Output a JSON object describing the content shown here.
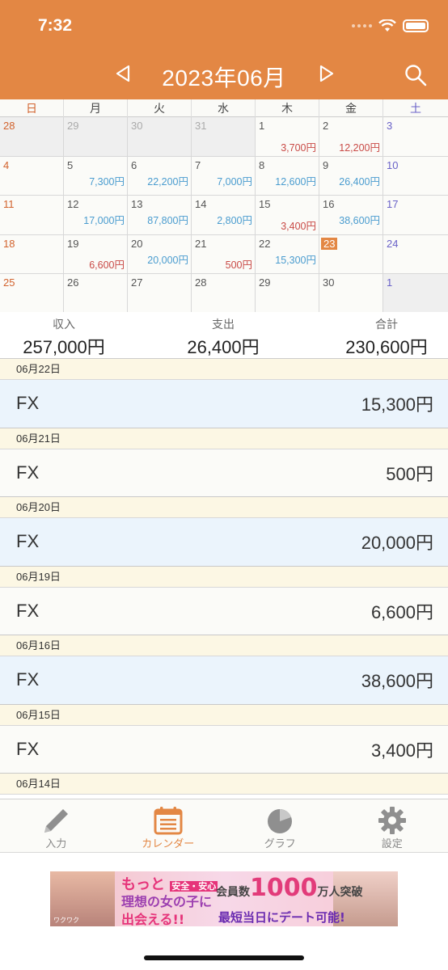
{
  "status_bar": {
    "time": "7:32"
  },
  "header": {
    "title": "2023年06月",
    "prev_icon": "triangle-left",
    "next_icon": "triangle-right",
    "search_icon": "magnifier"
  },
  "weekdays": [
    "日",
    "月",
    "火",
    "水",
    "木",
    "金",
    "土"
  ],
  "calendar": {
    "today": "23",
    "colors": {
      "accent": "#e38744",
      "income": "#4a9ccf",
      "expense": "#c94a46",
      "sunday": "#d2632e",
      "saturday": "#6a62c8"
    },
    "weeks": [
      [
        {
          "day": "28",
          "other": true
        },
        {
          "day": "29",
          "other": true
        },
        {
          "day": "30",
          "other": true
        },
        {
          "day": "31",
          "other": true
        },
        {
          "day": "1",
          "expense": "3,700円"
        },
        {
          "day": "2",
          "expense": "12,200円"
        },
        {
          "day": "3"
        }
      ],
      [
        {
          "day": "4"
        },
        {
          "day": "5",
          "income": "7,300円"
        },
        {
          "day": "6",
          "income": "22,200円"
        },
        {
          "day": "7",
          "income": "7,000円"
        },
        {
          "day": "8",
          "income": "12,600円"
        },
        {
          "day": "9",
          "income": "26,400円"
        },
        {
          "day": "10"
        }
      ],
      [
        {
          "day": "11"
        },
        {
          "day": "12",
          "income": "17,000円"
        },
        {
          "day": "13",
          "income": "87,800円"
        },
        {
          "day": "14",
          "income": "2,800円"
        },
        {
          "day": "15",
          "expense": "3,400円"
        },
        {
          "day": "16",
          "income": "38,600円"
        },
        {
          "day": "17"
        }
      ],
      [
        {
          "day": "18"
        },
        {
          "day": "19",
          "expense": "6,600円"
        },
        {
          "day": "20",
          "income": "20,000円"
        },
        {
          "day": "21",
          "expense": "500円"
        },
        {
          "day": "22",
          "income": "15,300円"
        },
        {
          "day": "23"
        },
        {
          "day": "24"
        }
      ],
      [
        {
          "day": "25"
        },
        {
          "day": "26"
        },
        {
          "day": "27"
        },
        {
          "day": "28"
        },
        {
          "day": "29"
        },
        {
          "day": "30"
        },
        {
          "day": "1",
          "other": true
        }
      ]
    ]
  },
  "summary": {
    "income_label": "収入",
    "income_value": "257,000円",
    "expense_label": "支出",
    "expense_value": "26,400円",
    "total_label": "合計",
    "total_value": "230,600円"
  },
  "transactions": [
    {
      "date": "06月22日",
      "category": "FX",
      "amount": "15,300円",
      "type": "income"
    },
    {
      "date": "06月21日",
      "category": "FX",
      "amount": "500円",
      "type": "expense"
    },
    {
      "date": "06月20日",
      "category": "FX",
      "amount": "20,000円",
      "type": "income"
    },
    {
      "date": "06月19日",
      "category": "FX",
      "amount": "6,600円",
      "type": "expense"
    },
    {
      "date": "06月16日",
      "category": "FX",
      "amount": "38,600円",
      "type": "income"
    },
    {
      "date": "06月15日",
      "category": "FX",
      "amount": "3,400円",
      "type": "expense"
    },
    {
      "date": "06月14日",
      "category": "",
      "amount": "",
      "type": "income"
    }
  ],
  "tabs": [
    {
      "label": "入力",
      "icon": "pencil-icon",
      "active": false
    },
    {
      "label": "カレンダー",
      "icon": "calendar-icon",
      "active": true
    },
    {
      "label": "グラフ",
      "icon": "pie-chart-icon",
      "active": false
    },
    {
      "label": "設定",
      "icon": "gear-icon",
      "active": false
    }
  ],
  "ad": {
    "line1": "もっと",
    "line1b": "安全・安心",
    "line2": "理想の女の子に",
    "line3": "出会える!!",
    "badge_prefix": "会員数",
    "badge": "1000",
    "badge_suffix": "万人突破",
    "line4": "最短当日にデート可能!",
    "brand": "ワクワク"
  }
}
